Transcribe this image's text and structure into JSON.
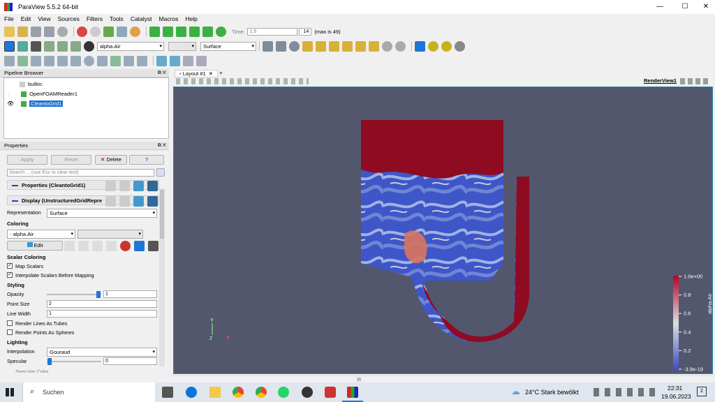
{
  "window": {
    "title": "ParaView 5.5.2 64-bit",
    "minimize": "—",
    "maximize": "☐",
    "close": "✕"
  },
  "menu": [
    "File",
    "Edit",
    "View",
    "Sources",
    "Filters",
    "Tools",
    "Catalyst",
    "Macros",
    "Help"
  ],
  "time": {
    "label": "Time:",
    "value": "1.5",
    "step": "14",
    "max": "(max is 49)"
  },
  "toolbar2": {
    "array": "alpha.Air",
    "component": "",
    "representation": "Surface"
  },
  "pipeline": {
    "title": "Pipeline Browser",
    "items": [
      {
        "label": "builtin:"
      },
      {
        "label": "OpenFOAMReader1"
      },
      {
        "label": "CleantoGrid1"
      }
    ]
  },
  "properties": {
    "title": "Properties",
    "apply": "Apply",
    "reset": "Reset",
    "delete": "Delete",
    "help": "?",
    "search_placeholder": "Search ... (use Esc to clear text)",
    "section_properties": "Properties (CleantoGrid1)",
    "section_display": "Display (UnstructuredGridRepre",
    "representation_label": "Representation",
    "representation_value": "Surface",
    "coloring_header": "Coloring",
    "coloring_array": "alpha.Air",
    "edit": "Edit",
    "scalar_coloring_header": "Scalar Coloring",
    "map_scalars": "Map Scalars",
    "interpolate_scalars": "Interpolate Scalars Before Mapping",
    "styling_header": "Styling",
    "opacity_label": "Opacity",
    "opacity_value": "1",
    "point_size_label": "Point Size",
    "point_size_value": "2",
    "line_width_label": "Line Width",
    "line_width_value": "1",
    "render_lines_tubes": "Render Lines As Tubes",
    "render_points_spheres": "Render Points As Spheres",
    "lighting_header": "Lighting",
    "interpolation_label": "Interpolation",
    "interpolation_value": "Gouraud",
    "specular_label": "Specular",
    "specular_value": "0",
    "specular_color": "Specular Color"
  },
  "layout": {
    "tab": "Layout #1",
    "add_tab": "+",
    "view_name": "RenderView1"
  },
  "legend": {
    "title": "alpha.Air",
    "ticks": [
      "1.0e+00",
      "0.8",
      "0.6",
      "0.4",
      "0.2",
      "-3.9e-19"
    ]
  },
  "axes": {
    "y": "Y",
    "z": "Z",
    "x": "X"
  },
  "taskbar": {
    "search": "Suchen",
    "weather": "24°C  Stark bewölkt",
    "time": "22:31",
    "date": "19.06.2023",
    "notifications": "2"
  },
  "colors": {
    "render_bg": "#52576d",
    "air_red": "#8e0b22",
    "water_blue": "#3f56c8",
    "accent": "#1e77d6"
  }
}
